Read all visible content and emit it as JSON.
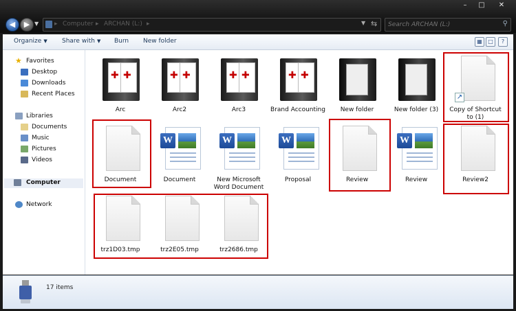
{
  "window": {
    "controls": {
      "minimize": "–",
      "maximize": "□",
      "close": "✕"
    }
  },
  "address": {
    "crumbs": [
      "Computer",
      "ARCHAN (L:)"
    ],
    "search_placeholder": "Search ARCHAN (L:)"
  },
  "commandbar": {
    "organize": "Organize",
    "share_with": "Share with",
    "burn": "Burn",
    "new_folder": "New folder"
  },
  "navigation": {
    "favorites": {
      "title": "Favorites",
      "items": [
        "Desktop",
        "Downloads",
        "Recent Places"
      ]
    },
    "libraries": {
      "title": "Libraries",
      "items": [
        "Documents",
        "Music",
        "Pictures",
        "Videos"
      ]
    },
    "computer": "Computer",
    "network": "Network"
  },
  "files": [
    {
      "name": "Arc",
      "icon": "pdf-folder-icon"
    },
    {
      "name": "Arc2",
      "icon": "pdf-folder-icon"
    },
    {
      "name": "Arc3",
      "icon": "pdf-folder-icon"
    },
    {
      "name": "Brand Accounting",
      "icon": "pdf-folder-icon"
    },
    {
      "name": "New folder",
      "icon": "folder-icon"
    },
    {
      "name": "New folder (3)",
      "icon": "folder-icon"
    },
    {
      "name": "Copy of Shortcut to (1)",
      "icon": "shortcut-file-icon"
    },
    {
      "name": "Document",
      "icon": "blank-file-icon"
    },
    {
      "name": "Document",
      "icon": "word-document-icon"
    },
    {
      "name": "New Microsoft Word Document",
      "icon": "word-document-icon"
    },
    {
      "name": "Proposal",
      "icon": "word-document-icon"
    },
    {
      "name": "Review",
      "icon": "blank-file-icon"
    },
    {
      "name": "Review",
      "icon": "word-document-icon"
    },
    {
      "name": "Review2",
      "icon": "blank-file-icon"
    },
    {
      "name": "trz1D03.tmp",
      "icon": "blank-file-icon"
    },
    {
      "name": "trz2E05.tmp",
      "icon": "blank-file-icon"
    },
    {
      "name": "trz2686.tmp",
      "icon": "blank-file-icon"
    }
  ],
  "details": {
    "item_count": "17 items"
  },
  "colors": {
    "highlight_box": "#cc0000",
    "accent": "#1e395b"
  }
}
